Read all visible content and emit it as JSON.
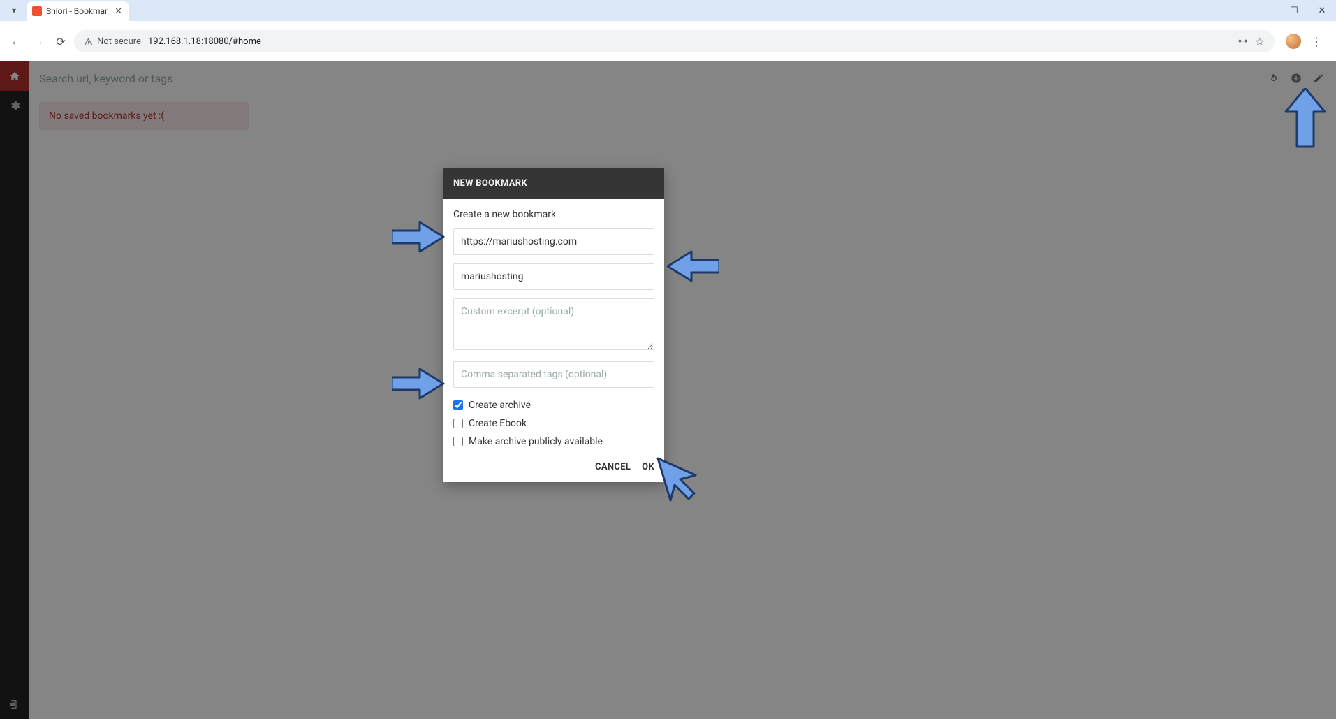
{
  "browser": {
    "tab_title": "Shiori - Bookmar",
    "not_secure_label": "Not secure",
    "url": "192.168.1.18:18080/#home"
  },
  "shiori": {
    "search_placeholder": "Search url, keyword or tags",
    "empty_message": "No saved bookmarks yet :("
  },
  "modal": {
    "title": "NEW BOOKMARK",
    "subtitle": "Create a new bookmark",
    "url_value": "https://mariushosting.com",
    "title_value": "mariushosting",
    "excerpt_placeholder": "Custom excerpt (optional)",
    "tags_placeholder": "Comma separated tags (optional)",
    "create_archive_label": "Create archive",
    "create_ebook_label": "Create Ebook",
    "make_public_label": "Make archive publicly available",
    "cancel_label": "CANCEL",
    "ok_label": "OK"
  }
}
